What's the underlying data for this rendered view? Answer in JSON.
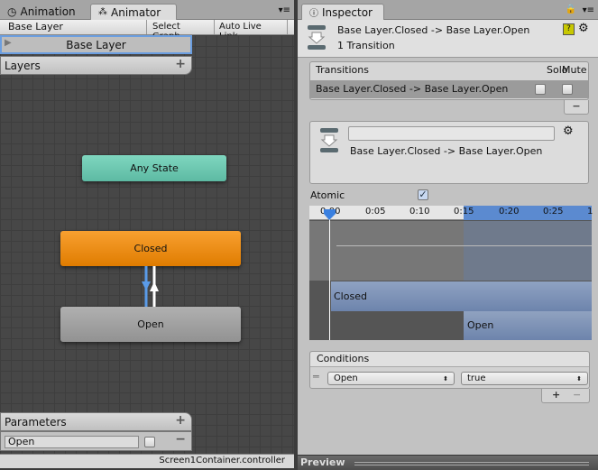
{
  "left": {
    "tabs": [
      {
        "label": "Animation",
        "icon": "clock-icon"
      },
      {
        "label": "Animator",
        "icon": "animator-icon"
      }
    ],
    "breadcrumb": "Base Layer",
    "select_graph": "Select Graph",
    "auto_live_link": "Auto Live Link",
    "layers": {
      "items": [
        "Base Layer"
      ],
      "header": "Layers",
      "add": "+"
    },
    "nodes": {
      "any_state": "Any State",
      "closed": "Closed",
      "open": "Open"
    },
    "node_colors": {
      "any_state": "#6fcab2",
      "closed": "#f08a10",
      "open": "#a3a3a3"
    },
    "parameters": {
      "header": "Parameters",
      "add": "+",
      "items": [
        {
          "name": "Open",
          "value": false
        }
      ],
      "remove": "−"
    },
    "status": "Screen1Container.controller"
  },
  "inspector": {
    "tab": "Inspector",
    "title": "Base Layer.Closed -> Base Layer.Open",
    "subtitle": "1 Transition",
    "transitions": {
      "header": "Transitions",
      "solo": "Solo",
      "mute": "Mute",
      "rows": [
        {
          "name": "Base Layer.Closed -> Base Layer.Open",
          "solo": false,
          "mute": false
        }
      ],
      "remove": "−"
    },
    "transition_name": "Base Layer.Closed -> Base Layer.Open",
    "name_field": "",
    "atomic_label": "Atomic",
    "atomic": true,
    "timeline": {
      "ticks": [
        "0:00",
        "0:05",
        "0:10",
        "0:15",
        "0:20",
        "0:25",
        "1"
      ],
      "source": "Closed",
      "dest": "Open"
    },
    "conditions": {
      "header": "Conditions",
      "parameter": "Open",
      "value": "true",
      "add": "+",
      "remove": "−"
    },
    "preview": "Preview",
    "accent": "#5b8ad0"
  }
}
